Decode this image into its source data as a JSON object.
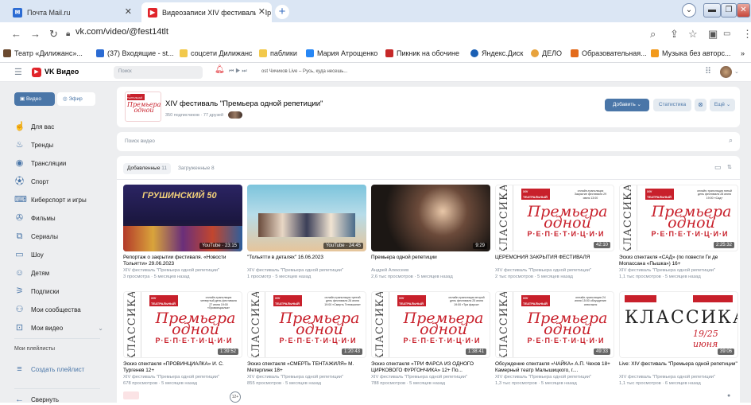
{
  "browser": {
    "tabs": [
      {
        "title": "Почта Mail.ru",
        "active": false
      },
      {
        "title": "Видеозаписи XIV фестиваль \"Пр",
        "active": true
      }
    ],
    "new_tab": "+",
    "url": "vk.com/video/@fest14tlt",
    "bookmarks": [
      "Театр «Дилижанс»...",
      "(37) Входящие - st...",
      "соцсети Дилижанс",
      "паблики",
      "Мария Атрощенко",
      "Пикник на обочине",
      "Яндекс.Диск",
      "ДЕЛО",
      "Образовательная...",
      "Музыка без авторс..."
    ],
    "more_bookmarks": "»"
  },
  "vk": {
    "logo": "VK Видео",
    "search_placeholder": "Поиск",
    "player_text": "ost Чичиков Live – Русь, куда несешь..."
  },
  "sidebar": {
    "video_btn": "Видео",
    "live_btn": "Эфир",
    "items": [
      "Для вас",
      "Тренды",
      "Трансляции",
      "Спорт",
      "Киберспорт и игры",
      "Фильмы",
      "Сериалы",
      "Шоу",
      "Детям",
      "Подписки",
      "Мои сообщества",
      "Мои видео"
    ],
    "playlists_title": "Мои плейлисты",
    "create_playlist": "Создать плейлист",
    "collapse": "Свернуть"
  },
  "channel": {
    "logo_text": "XIV ТЕАТРАЛЬНЫЙ ФЕСТИВАЛЬ",
    "title": "XIV фестиваль \"Премьера одной репетиции\"",
    "subs": "350 подписчиков · 77 друзей",
    "add_btn": "Добавить",
    "stats_btn": "Статистика",
    "more_btn": "Ещё"
  },
  "video_search_placeholder": "Поиск видео",
  "tabs": {
    "added": "Добавленные",
    "added_count": "11",
    "uploaded": "Загруженные",
    "uploaded_count": "8"
  },
  "premiere": {
    "side": "КЛАССИКА",
    "logo": "XIV ТЕАТРАЛЬНЫЙ ФЕСТИВАЛЬ",
    "script": "Премьера одной",
    "dots": "Р·Е·П·Е·Т·И·Ц·И·И"
  },
  "videos": [
    {
      "title": "Репортаж о закрытии фестиваля. «Новости Тольятти» 29.06.2023",
      "author": "XIV фестиваль \"Премьера одной репетиции\"",
      "stats": "3 просмотра · 5 месяцев назад",
      "dur": "YouTube · 23:15",
      "thumb": "stage",
      "thumb_text": "ГРУШИНСКИЙ 50"
    },
    {
      "title": "\"Тольятти в деталях\" 16.06.2023",
      "author": "XIV фестиваль \"Премьера одной репетиции\"",
      "stats": "1 просмотр · 5 месяцев назад",
      "dur": "YouTube · 24:45",
      "thumb": "studio"
    },
    {
      "title": "Премьера одной репетиции",
      "author": "Андрей Алексеев",
      "stats": "2,6 тыс просмотров · 5 месяцев назад",
      "dur": "9:29",
      "thumb": "portrait"
    },
    {
      "title": "ЦЕРЕМОНИЯ ЗАКРЫТИЯ ФЕСТИВАЛЯ",
      "author": "XIV фестиваль \"Премьера одной репетиции\"",
      "stats": "2 тыс просмотров · 5 месяцев назад",
      "dur": "42:10",
      "thumb": "premiere",
      "ptxt": "онлайн-трансляция Закрытие фестиваля 29 июня 13:00"
    },
    {
      "title": "Эскиз спектакля «САД» (по повести Ги де Мопассана «Пышка») 16+",
      "author": "XIV фестиваль \"Премьера одной репетиции\"",
      "stats": "1,1 тыс просмотров · 5 месяцев назад",
      "dur": "2:25:32",
      "thumb": "premiere",
      "ptxt": "онлайн-трансляция пятый день фестиваля 28 июня 19:00 «Сад»"
    },
    {
      "title": "Эскиз спектакля «ПРОВИНЦИАЛКА» И. С. Тургенев 12+",
      "author": "XIV фестиваль \"Премьера одной репетиции\"",
      "stats": "678 просмотров · 5 месяцев назад",
      "dur": "1:39:52",
      "thumb": "premiere",
      "ptxt": "онлайн-трансляция четвертый день фестиваля 27 июня 19:00 «Провинциалка»"
    },
    {
      "title": "Эскиз спектакля «СМЕРТЬ ТЕНТАЖИЛЯ» М. Метерлинк 18+",
      "author": "XIV фестиваль \"Премьера одной репетиции\"",
      "stats": "855 просмотров · 5 месяцев назад",
      "dur": "1:20:43",
      "thumb": "premiere",
      "ptxt": "онлайн-трансляция третий день фестиваля 26 июня 19:00 «Смерть Тентажиля»"
    },
    {
      "title": "Эскиз спектакля «ТРИ ФАРСА ИЗ ОДНОГО ЦИРКОВОГО ФУРГОНЧИКА» 12+ По...",
      "author": "XIV фестиваль \"Премьера одной репетиции\"",
      "stats": "788 просмотров · 5 месяцев назад",
      "dur": "1:38:41",
      "thumb": "premiere",
      "ptxt": "онлайн-трансляция второй день фестиваля 25 июня 19:00 «Три фарса»"
    },
    {
      "title": "Обсуждение спектакля «ЧАЙКА» А.П. Чехов 18+ Камерный театр Малышицкого, г....",
      "author": "XIV фестиваль \"Премьера одной репетиции\"",
      "stats": "1,3 тыс просмотров · 5 месяцев назад",
      "dur": "49:33",
      "thumb": "premiere",
      "ptxt": "онлайн-трансляция 24 июня 15:00 обсуждение спектакля"
    },
    {
      "title": "Live: XIV фестиваль \"Премьера одной репетиции\"",
      "author": "XIV фестиваль \"Премьера одной репетиции\"",
      "stats": "1,1 тыс просмотров · 6 месяцев назад",
      "dur": "39:06",
      "thumb": "klassika",
      "thumb_text": "КЛАССИКА",
      "date": "19/25 июня"
    }
  ],
  "more_count": "12+"
}
